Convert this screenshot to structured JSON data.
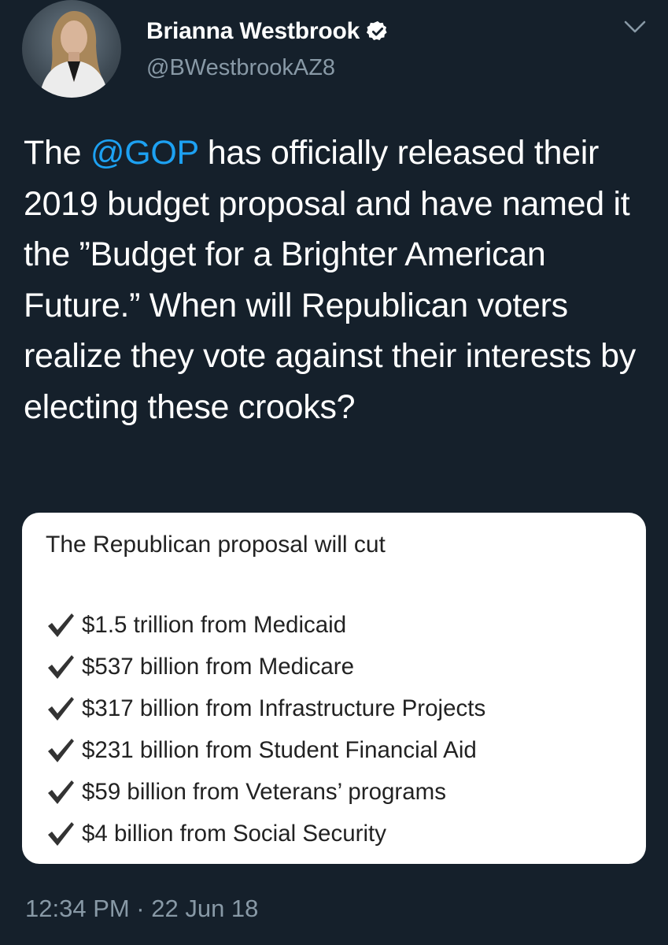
{
  "author": {
    "name": "Brianna Westbrook",
    "handle": "@BWestbrookAZ8",
    "verified_icon": "verified-badge-icon",
    "avatar": "profile-photo"
  },
  "tweet": {
    "text_before_mention": "The ",
    "mention": "@GOP",
    "text_after_mention": " has officially released their 2019 budget proposal and have named it the ”Budget for a Brighter American Future.” When will Republican voters realize they vote against their interests by electing these crooks?",
    "timestamp": "12:34 PM · 22 Jun 18"
  },
  "card": {
    "title": "The Republican proposal will cut",
    "items": [
      "$1.5 trillion from Medicaid",
      "$537 billion from Medicare",
      "$317 billion from Infrastructure Projects",
      "$231 billion from Student Financial Aid",
      "$59 billion from Veterans’ programs",
      "$4 billion from Social Security"
    ]
  },
  "colors": {
    "background": "#15202b",
    "mention": "#1da1f2",
    "secondary_text": "#8899a6",
    "card": "#ffffff",
    "check": "#333333"
  }
}
